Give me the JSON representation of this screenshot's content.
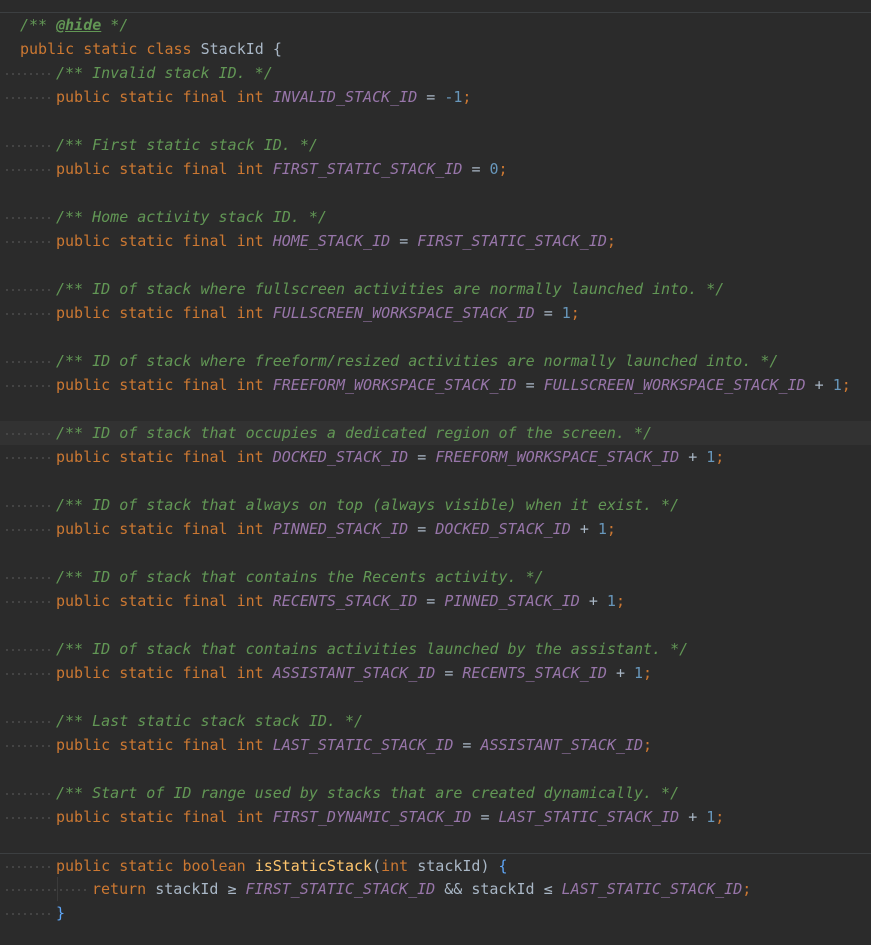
{
  "editor": {
    "javadoc_open": "/** ",
    "javadoc_tag": "@hide",
    "javadoc_close": " */",
    "class_decl": {
      "modifiers": "public static class ",
      "name": "StackId",
      "brace": " {"
    },
    "keywords": {
      "public": "public",
      "static": "static",
      "final": "final",
      "int": "int",
      "boolean": "boolean",
      "return": "return"
    },
    "constants": [
      {
        "comment": "/** Invalid stack ID. */",
        "name": "INVALID_STACK_ID",
        "rhs_field": "",
        "rhs_num": "-1",
        "plus": false
      },
      {
        "comment": "/** First static stack ID. */",
        "name": "FIRST_STATIC_STACK_ID",
        "rhs_field": "",
        "rhs_num": "0",
        "plus": false
      },
      {
        "comment": "/** Home activity stack ID. */",
        "name": "HOME_STACK_ID",
        "rhs_field": "FIRST_STATIC_STACK_ID",
        "rhs_num": "",
        "plus": false
      },
      {
        "comment": "/** ID of stack where fullscreen activities are normally launched into. */",
        "name": "FULLSCREEN_WORKSPACE_STACK_ID",
        "rhs_field": "",
        "rhs_num": "1",
        "plus": false
      },
      {
        "comment": "/** ID of stack where freeform/resized activities are normally launched into. */",
        "name": "FREEFORM_WORKSPACE_STACK_ID",
        "rhs_field": "FULLSCREEN_WORKSPACE_STACK_ID",
        "rhs_num": "1",
        "plus": true
      },
      {
        "comment": "/** ID of stack that occupies a dedicated region of the screen. */",
        "name": "DOCKED_STACK_ID",
        "rhs_field": "FREEFORM_WORKSPACE_STACK_ID",
        "rhs_num": "1",
        "plus": true
      },
      {
        "comment": "/** ID of stack that always on top (always visible) when it exist. */",
        "name": "PINNED_STACK_ID",
        "rhs_field": "DOCKED_STACK_ID",
        "rhs_num": "1",
        "plus": true
      },
      {
        "comment": "/** ID of stack that contains the Recents activity. */",
        "name": "RECENTS_STACK_ID",
        "rhs_field": "PINNED_STACK_ID",
        "rhs_num": "1",
        "plus": true
      },
      {
        "comment": "/** ID of stack that contains activities launched by the assistant. */",
        "name": "ASSISTANT_STACK_ID",
        "rhs_field": "RECENTS_STACK_ID",
        "rhs_num": "1",
        "plus": true
      },
      {
        "comment": "/** Last static stack stack ID. */",
        "name": "LAST_STATIC_STACK_ID",
        "rhs_field": "ASSISTANT_STACK_ID",
        "rhs_num": "",
        "plus": false
      },
      {
        "comment": "/** Start of ID range used by stacks that are created dynamically. */",
        "name": "FIRST_DYNAMIC_STACK_ID",
        "rhs_field": "LAST_STATIC_STACK_ID",
        "rhs_num": "1",
        "plus": true
      }
    ],
    "method": {
      "name": "isStaticStack",
      "param_type": "int",
      "param_name": "stackId",
      "return_expr": {
        "var1": "stackId",
        "op1": "≥",
        "field1": "FIRST_STATIC_STACK_ID",
        "and": "&&",
        "var2": "stackId",
        "op2": "≤",
        "field2": "LAST_STATIC_STACK_ID"
      },
      "close_brace": "}"
    },
    "highlighted_line_index": 5,
    "colors": {
      "background": "#2b2b2b",
      "keyword": "#cc7832",
      "comment": "#629755",
      "field": "#9876aa",
      "number": "#6897bb",
      "method": "#ffc66d",
      "text": "#a9b7c6"
    }
  }
}
